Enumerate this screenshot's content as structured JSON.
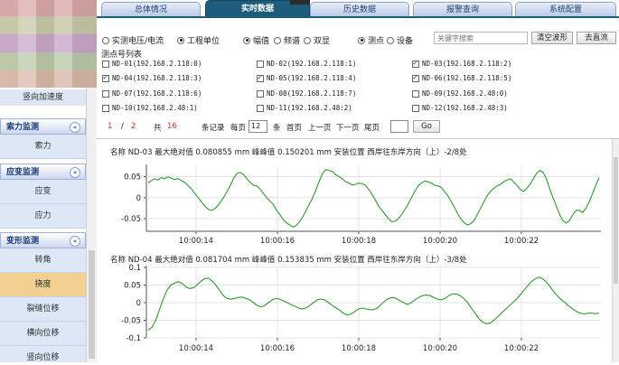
{
  "sidebar": {
    "static_item": "竖向加速度",
    "groups": [
      {
        "title": "索力监测",
        "items": [
          {
            "label": "索力",
            "active": false
          }
        ]
      },
      {
        "title": "应变监测",
        "items": [
          {
            "label": "应变",
            "active": false
          },
          {
            "label": "应力",
            "active": false
          }
        ]
      },
      {
        "title": "变形监测",
        "items": [
          {
            "label": "转角",
            "active": false
          },
          {
            "label": "挠度",
            "active": true
          },
          {
            "label": "裂缝位移",
            "active": false
          },
          {
            "label": "横向位移",
            "active": false
          },
          {
            "label": "竖向位移",
            "active": false
          }
        ]
      }
    ],
    "collapse_glyph": "«"
  },
  "tabs": [
    {
      "label": "总体情况",
      "active": false
    },
    {
      "label": "实时数据",
      "active": true
    },
    {
      "label": "历史数据",
      "active": false
    },
    {
      "label": "报警查询",
      "active": false
    },
    {
      "label": "系统配置",
      "active": false
    }
  ],
  "options": {
    "unit_group": [
      {
        "label": "实测电压/电流",
        "checked": false
      },
      {
        "label": "工程单位",
        "checked": true
      }
    ],
    "mode_group": [
      {
        "label": "幅值",
        "checked": true
      },
      {
        "label": "频谱",
        "checked": false
      },
      {
        "label": "双显",
        "checked": false
      }
    ],
    "target_group": [
      {
        "label": "测点",
        "checked": true
      },
      {
        "label": "设备",
        "checked": false
      }
    ],
    "search_placeholder": "关键字搜索",
    "clear_waveform": "清空波形",
    "remove_dc": "去直流"
  },
  "point_list": {
    "title": "测点号列表",
    "items": [
      {
        "label": "ND-01(192.168.2.118:0)",
        "checked": false
      },
      {
        "label": "ND-02(192.168.2.118:1)",
        "checked": false
      },
      {
        "label": "ND-03(192.168.2.118:2)",
        "checked": true
      },
      {
        "label": "ND-04(192.168.2.118:3)",
        "checked": true
      },
      {
        "label": "ND-05(192.168.2.118:4)",
        "checked": true
      },
      {
        "label": "ND-06(192.168.2.118:5)",
        "checked": true
      },
      {
        "label": "ND-07(192.168.2.118:6)",
        "checked": false
      },
      {
        "label": "ND-08(192.168.2.118:7)",
        "checked": false
      },
      {
        "label": "ND-09(192.168.2.48:0)",
        "checked": false
      },
      {
        "label": "ND-10(192.168.2.48:1)",
        "checked": false
      },
      {
        "label": "ND-11(192.168.2.48:2)",
        "checked": false
      },
      {
        "label": "ND-12(192.168.2.48:3)",
        "checked": false
      }
    ]
  },
  "pagination": {
    "current": "1",
    "sep": "/",
    "pages": "2",
    "total_label": "共",
    "total": "16",
    "records_label": "条记录",
    "per_page_label": "每页",
    "per_page": "12",
    "per_page_unit": "条",
    "first": "首页",
    "prev": "上一页",
    "next": "下一页",
    "last": "尾页",
    "jump_value": "",
    "go": "Go"
  },
  "chart_data": [
    {
      "type": "line",
      "title": "名称 ND-03 最大绝对值 0.080855 mm 峰峰值 0.150201 mm 安装位置 西岸往东岸方向（上）-2/8处",
      "x_ticks": [
        "10:00:14",
        "10:00:16",
        "10:00:18",
        "10:00:20",
        "10:00:22"
      ],
      "y_ticks": [
        0.05,
        0,
        -0.05
      ],
      "ylim": [
        -0.08,
        0.075
      ],
      "color": "#2f9a2f",
      "series": [
        {
          "values": [
            0.035,
            0.041,
            0.045,
            0.042,
            0.048,
            0.045,
            0.05,
            0.047,
            0.043,
            0.046,
            0.041,
            0.037,
            0.03,
            0.022,
            0.012,
            0.002,
            -0.008,
            -0.018,
            -0.026,
            -0.03,
            -0.028,
            -0.02,
            -0.01,
            0.002,
            0.015,
            0.03,
            0.047,
            0.058,
            0.06,
            0.055,
            0.045,
            0.036,
            0.03,
            0.028,
            0.02,
            0.01,
            0.0,
            -0.008,
            -0.016,
            -0.03,
            -0.04,
            -0.052,
            -0.06,
            -0.065,
            -0.07,
            -0.066,
            -0.057,
            -0.045,
            -0.03,
            -0.015,
            0.0,
            0.02,
            0.04,
            0.058,
            0.067,
            0.065,
            0.062,
            0.055,
            0.05,
            0.045,
            0.038,
            0.035,
            0.03,
            0.032,
            0.035,
            0.033,
            0.03,
            0.02,
            0.008,
            -0.005,
            -0.02,
            -0.03,
            -0.04,
            -0.05,
            -0.057,
            -0.056,
            -0.05,
            -0.04,
            -0.028,
            -0.015,
            0.0,
            0.015,
            0.028,
            0.035,
            0.04,
            0.038,
            0.035,
            0.03,
            0.028,
            0.025,
            0.015,
            0.005,
            -0.008,
            -0.022,
            -0.038,
            -0.05,
            -0.06,
            -0.065,
            -0.062,
            -0.055,
            -0.04,
            -0.025,
            -0.01,
            0.005,
            0.015,
            0.022,
            0.028,
            0.032,
            0.038,
            0.042,
            0.045,
            0.038,
            0.03,
            0.02,
            0.015,
            0.022,
            0.032,
            0.045,
            0.058,
            0.065,
            0.06,
            0.045,
            0.02,
            0.0,
            -0.02,
            -0.04,
            -0.055,
            -0.06,
            -0.055,
            -0.04,
            -0.03,
            -0.03,
            -0.035,
            -0.025,
            -0.01,
            0.01,
            0.03,
            0.048
          ]
        }
      ]
    },
    {
      "type": "line",
      "title": "名称 ND-04 最大绝对值 0.081704 mm 峰峰值 0.153835 mm 安装位置 西岸往东岸方向（上）-3/8处",
      "x_ticks": [
        "10:00:14",
        "10:00:16",
        "10:00:18",
        "10:00:20",
        "10:00:22"
      ],
      "y_ticks": [
        0.1,
        0.05,
        0,
        -0.05,
        -0.1
      ],
      "ylim": [
        -0.1,
        0.1
      ],
      "color": "#2f9a2f",
      "series": [
        {
          "values": [
            -0.078,
            -0.07,
            -0.05,
            -0.02,
            0.01,
            0.035,
            0.05,
            0.055,
            0.06,
            0.055,
            0.045,
            0.04,
            0.042,
            0.05,
            0.06,
            0.068,
            0.07,
            0.062,
            0.05,
            0.035,
            0.02,
            0.012,
            0.01,
            0.012,
            0.015,
            0.016,
            0.012,
            0.008,
            0.0,
            -0.008,
            -0.012,
            -0.008,
            0.0,
            0.008,
            0.012,
            0.01,
            0.005,
            0.0,
            -0.005,
            -0.01,
            -0.015,
            -0.018,
            -0.015,
            -0.008,
            0.0,
            0.008,
            0.01,
            0.008,
            0.0,
            -0.008,
            -0.015,
            -0.022,
            -0.03,
            -0.035,
            -0.032,
            -0.025,
            -0.018,
            -0.015,
            -0.018,
            -0.02,
            -0.02,
            -0.015,
            -0.005,
            0.005,
            0.012,
            0.015,
            0.012,
            0.005,
            0.0,
            -0.005,
            0.0,
            0.008,
            0.015,
            0.02,
            0.022,
            0.02,
            0.015,
            0.01,
            0.008,
            0.012,
            0.02,
            0.025,
            0.025,
            0.02,
            0.012,
            0.0,
            -0.015,
            -0.03,
            -0.045,
            -0.055,
            -0.06,
            -0.058,
            -0.05,
            -0.04,
            -0.03,
            -0.02,
            -0.01,
            0.0,
            0.01,
            0.022,
            0.035,
            0.048,
            0.06,
            0.068,
            0.072,
            0.068,
            0.058,
            0.045,
            0.03,
            0.018,
            0.008,
            0.0,
            -0.01,
            -0.018,
            -0.025,
            -0.03,
            -0.032,
            -0.03,
            -0.03,
            -0.031,
            -0.03
          ]
        }
      ]
    }
  ]
}
